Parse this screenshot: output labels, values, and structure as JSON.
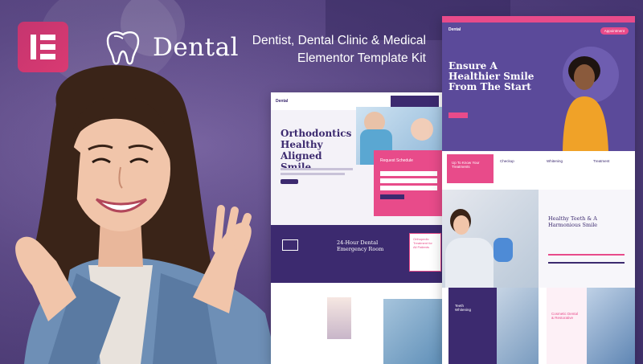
{
  "brand": {
    "name": "Dental",
    "tagline_line1": "Dentist, Dental Clinic & Medical",
    "tagline_line2": "Elementor Template Kit"
  },
  "colors": {
    "purple_dark": "#3c2a6f",
    "purple_mid": "#5b4a9a",
    "pink": "#e84b8a",
    "elementor": "#d93a72"
  },
  "mock_left": {
    "nav_brand": "Dental",
    "hero_title_line1": "Orthodontics",
    "hero_title_line2": "Healthy",
    "hero_title_line3": "Aligned Smile",
    "form_title": "Request Schedule",
    "emergency_line1": "24-Hour Dental",
    "emergency_line2": "Emergency Room",
    "side_line1": "Orthopedic",
    "side_line2": "Treatment for",
    "side_line3": "All Patients"
  },
  "mock_right": {
    "nav_brand": "Dental",
    "nav_button": "Appointment",
    "hero_title_line1": "Ensure A",
    "hero_title_line2": "Healthier Smile",
    "hero_title_line3": "From The Start",
    "features_title_line1": "Up To Know Your",
    "features_title_line2": "Treatments",
    "feature1": "Checkup",
    "feature2": "Whitening",
    "feature3": "Treatment",
    "section2_title_line1": "Healthy Teeth & A",
    "section2_title_line2": "Harmonious Smile",
    "card_line1": "Teeth",
    "card_line2": "Whitening",
    "card2_line1": "Cosmetic Dental",
    "card2_line2": "& Restorative"
  },
  "icons": [
    "elementor-logo-icon",
    "tooth-icon",
    "check-icon",
    "calendar-icon"
  ]
}
